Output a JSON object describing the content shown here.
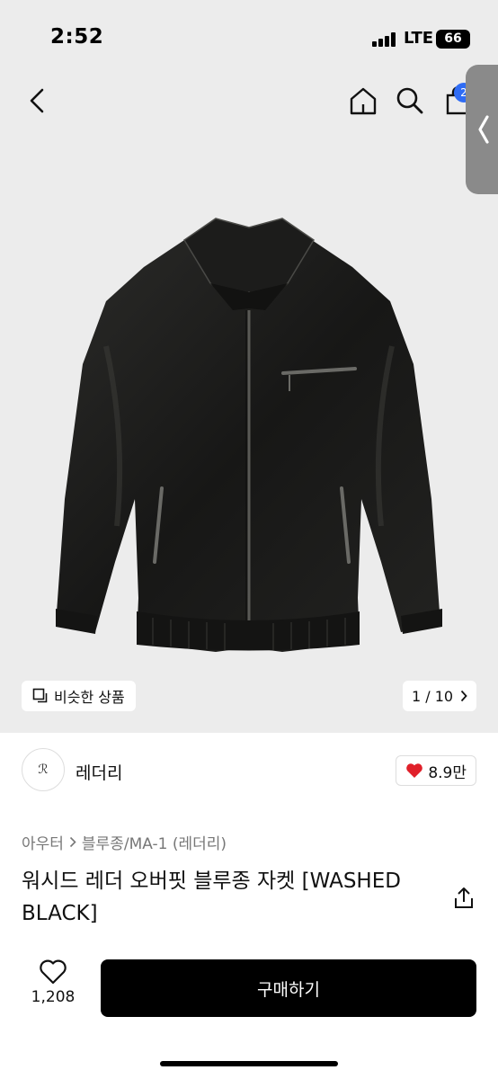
{
  "status_bar": {
    "time": "2:52",
    "network": "LTE",
    "battery": "66"
  },
  "nav": {
    "cart_badge": "2"
  },
  "gallery": {
    "similar_label": "비슷한 상품",
    "page_indicator": "1 / 10"
  },
  "brand": {
    "name": "레더리",
    "like_count": "8.9만"
  },
  "breadcrumb": {
    "root": "아우터",
    "category": "블루종/MA-1 (레더리)"
  },
  "product": {
    "title": "워시드 레더 오버핏 블루종 자켓 [WASHED BLACK]"
  },
  "bottom_bar": {
    "wish_count": "1,208",
    "buy_label": "구매하기"
  },
  "colors": {
    "accent_badge": "#2f6cf5",
    "heart": "#e0202a",
    "buy_button": "#000000"
  }
}
